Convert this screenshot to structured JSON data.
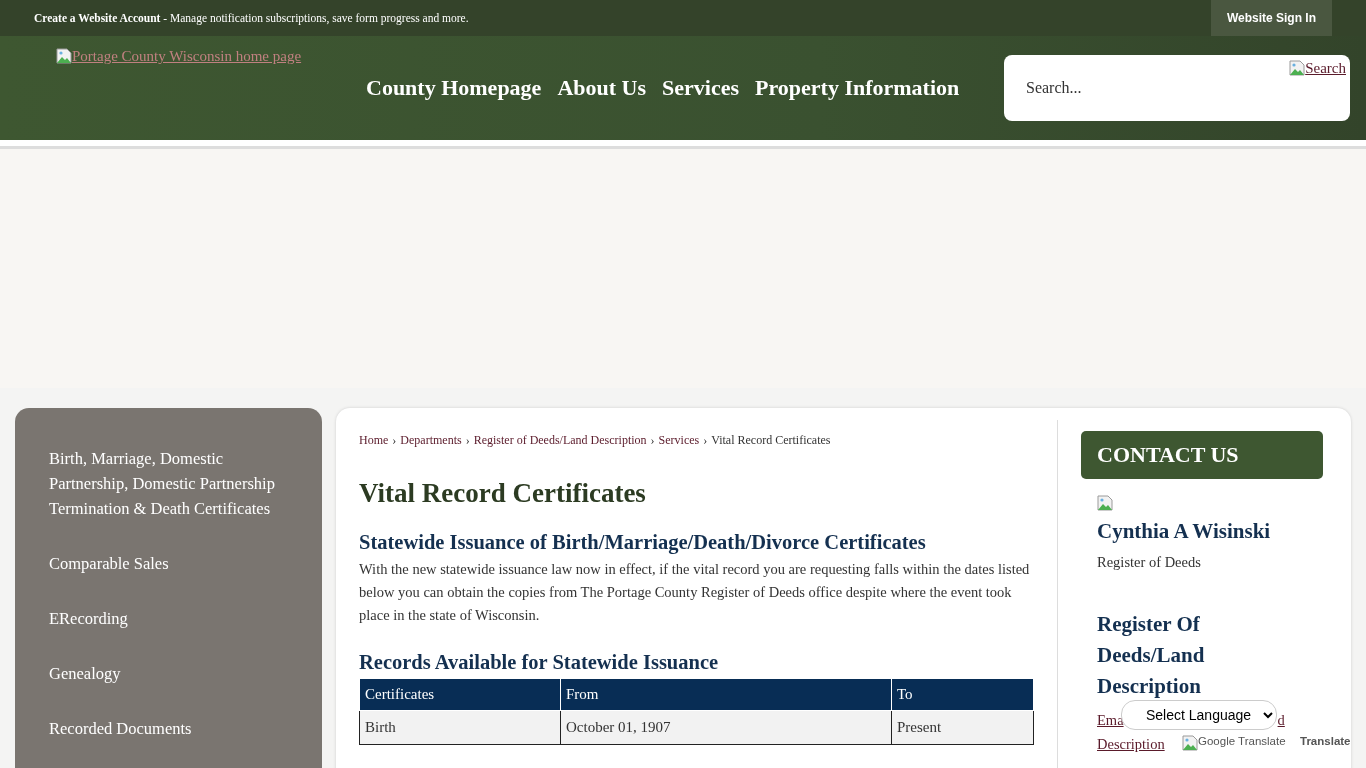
{
  "top_bar": {
    "account_link": "Create a Website Account",
    "account_text": " - Manage notification subscriptions, save form progress and more.",
    "sign_in": "Website Sign In"
  },
  "header": {
    "logo_alt": "Portage County Wisconsin home page",
    "nav": [
      "County Homepage",
      "About Us",
      "Services",
      "Property Information"
    ],
    "search": {
      "placeholder": "Search...",
      "button_alt": "Search"
    }
  },
  "sidebar": {
    "items": [
      {
        "label": "Birth, Marriage, Domestic Partnership, Domestic Partnership Termination & Death Certificates",
        "selected": false
      },
      {
        "label": "Comparable Sales",
        "selected": false
      },
      {
        "label": "ERecording",
        "selected": false
      },
      {
        "label": "Genealogy",
        "selected": false
      },
      {
        "label": "Recorded Documents",
        "selected": false
      }
    ]
  },
  "breadcrumbs": [
    {
      "label": "Home",
      "link": true
    },
    {
      "separator": "›",
      "label": "Departments",
      "link": true
    },
    {
      "separator": "›",
      "label": "Register of Deeds/Land Description",
      "link": true
    },
    {
      "separator": "›",
      "label": "Services",
      "link": true
    },
    {
      "separator": "›",
      "label": "Vital Record Certificates",
      "link": false
    }
  ],
  "page_title": "Vital Record Certificates",
  "section_1": {
    "heading": "Statewide Issuance of Birth/Marriage/Death/Divorce Certificates",
    "text": "With the new statewide issuance law now in effect, if the vital record you are requesting falls within the dates listed below you can obtain the copies from The Portage County Register of Deeds office despite where the event took place in the state of Wisconsin."
  },
  "section_2": {
    "heading": "Records Available for Statewide Issuance",
    "table": {
      "columns": [
        "Certificates",
        "From",
        "To"
      ],
      "rows": [
        [
          "Birth",
          "October 01, 1907",
          "Present"
        ]
      ]
    }
  },
  "contact": {
    "title": "CONTACT US",
    "name": "Cynthia A Wisinski",
    "role": "Register of Deeds",
    "department": "Register Of Deeds/Land Description",
    "email_link_parts": [
      "Ema",
      "d",
      "Description"
    ]
  },
  "translate": {
    "select": "Select Language",
    "logo_alt": "Google Translate",
    "label": "Translate"
  }
}
